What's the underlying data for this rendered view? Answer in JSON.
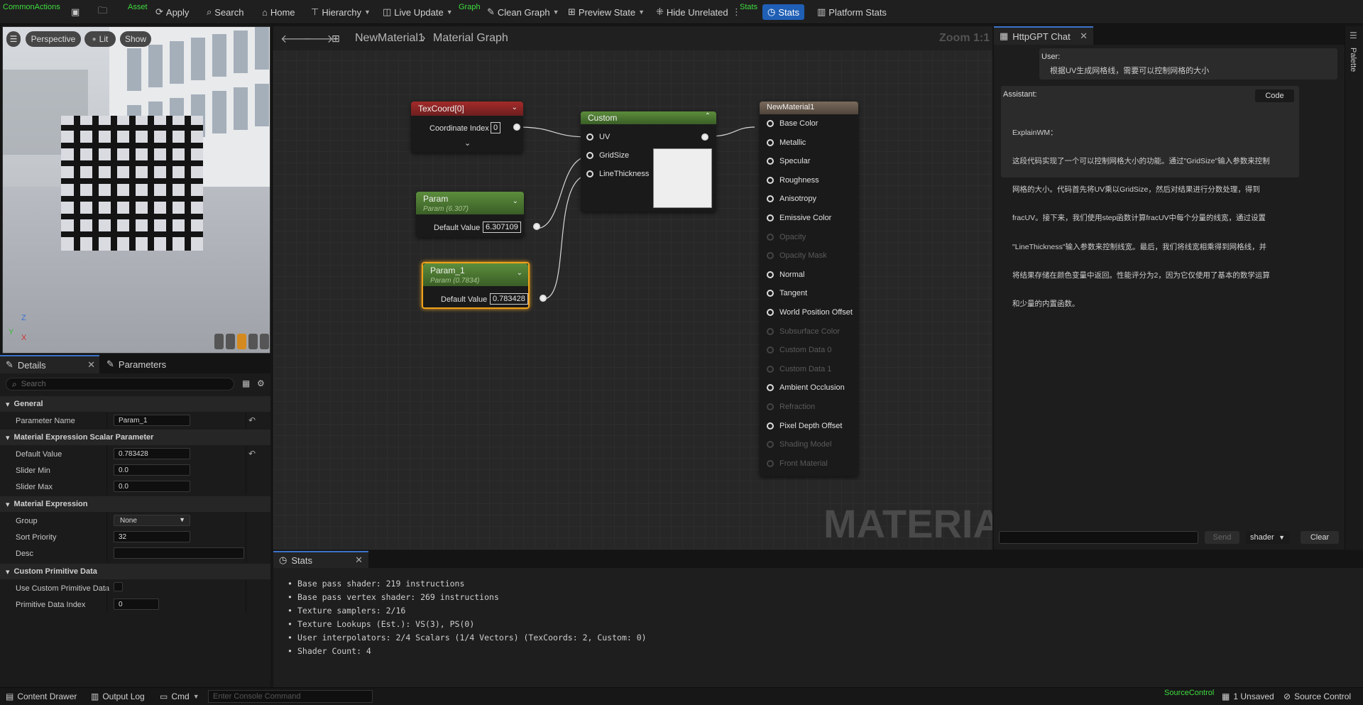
{
  "toolbar": {
    "sections": {
      "common_actions": "CommonActions",
      "asset": "Asset",
      "graph": "Graph",
      "stats": "Stats"
    },
    "apply": "Apply",
    "search": "Search",
    "home": "Home",
    "hierarchy": "Hierarchy",
    "live_update": "Live Update",
    "clean_graph": "Clean Graph",
    "preview_state": "Preview State",
    "hide_unrelated": "Hide Unrelated",
    "stats": "Stats",
    "platform_stats": "Platform Stats"
  },
  "viewport": {
    "perspective": "Perspective",
    "lit": "Lit",
    "show": "Show",
    "axis_z": "Z",
    "axis_y": "Y",
    "axis_x": "X"
  },
  "details": {
    "tab_details": "Details",
    "tab_parameters": "Parameters",
    "search_placeholder": "Search",
    "sections": {
      "general": "General",
      "scalar": "Material Expression Scalar Parameter",
      "expression": "Material Expression",
      "custom_primitive": "Custom Primitive Data"
    },
    "props": {
      "parameter_name": {
        "label": "Parameter Name",
        "value": "Param_1"
      },
      "default_value": {
        "label": "Default Value",
        "value": "0.783428"
      },
      "slider_min": {
        "label": "Slider Min",
        "value": "0.0"
      },
      "slider_max": {
        "label": "Slider Max",
        "value": "0.0"
      },
      "group": {
        "label": "Group",
        "value": "None"
      },
      "sort_priority": {
        "label": "Sort Priority",
        "value": "32"
      },
      "desc": {
        "label": "Desc",
        "value": ""
      },
      "use_custom_primitive": {
        "label": "Use Custom Primitive Data"
      },
      "primitive_index": {
        "label": "Primitive Data Index",
        "value": "0"
      }
    }
  },
  "graph": {
    "breadcrumb_material": "NewMaterial1",
    "breadcrumb_graph": "Material Graph",
    "zoom": "Zoom 1:1",
    "watermark": "MATERIAL",
    "texcoord": {
      "title": "TexCoord[0]",
      "coordinate_index_label": "Coordinate Index",
      "coordinate_index": "0"
    },
    "param": {
      "title": "Param",
      "subtitle": "Param (6.307)",
      "default_label": "Default Value",
      "default_value": "6.307109"
    },
    "param1": {
      "title": "Param_1",
      "subtitle": "Param (0.7834)",
      "default_label": "Default Value",
      "default_value": "0.783428"
    },
    "custom": {
      "title": "Custom",
      "pins": [
        "UV",
        "GridSize",
        "LineThickness"
      ]
    },
    "result": {
      "title": "NewMaterial1",
      "pins": [
        {
          "label": "Base Color",
          "active": true
        },
        {
          "label": "Metallic",
          "active": true
        },
        {
          "label": "Specular",
          "active": true
        },
        {
          "label": "Roughness",
          "active": true
        },
        {
          "label": "Anisotropy",
          "active": true
        },
        {
          "label": "Emissive Color",
          "active": true
        },
        {
          "label": "Opacity",
          "active": false
        },
        {
          "label": "Opacity Mask",
          "active": false
        },
        {
          "label": "Normal",
          "active": true
        },
        {
          "label": "Tangent",
          "active": true
        },
        {
          "label": "World Position Offset",
          "active": true
        },
        {
          "label": "Subsurface Color",
          "active": false
        },
        {
          "label": "Custom Data 0",
          "active": false
        },
        {
          "label": "Custom Data 1",
          "active": false
        },
        {
          "label": "Ambient Occlusion",
          "active": true
        },
        {
          "label": "Refraction",
          "active": false
        },
        {
          "label": "Pixel Depth Offset",
          "active": true
        },
        {
          "label": "Shading Model",
          "active": false
        },
        {
          "label": "Front Material",
          "active": false
        }
      ]
    }
  },
  "chat": {
    "tab_title": "HttpGPT Chat",
    "palette": "Palette",
    "user_label": "User:",
    "user_message": "根据UV生成网格线，需要可以控制网格的大小",
    "assistant_label": "Assistant:",
    "code_button": "Code",
    "assistant_lines": [
      "ExplainWM：",
      "这段代码实现了一个可以控制网格大小的功能。通过\"GridSize\"输入参数来控制",
      "网格的大小。代码首先将UV乘以GridSize，然后对结果进行分数处理，得到",
      "fracUV。接下来，我们使用step函数计算fracUV中每个分量的线宽，通过设置",
      "\"LineThickness\"输入参数来控制线宽。最后，我们将线宽相乘得到网格线，并",
      "将结果存储在颜色变量中返回。性能评分为2，因为它仅使用了基本的数学运算",
      "和少量的内置函数。"
    ],
    "send": "Send",
    "mode": "shader",
    "clear": "Clear"
  },
  "stats": {
    "tab": "Stats",
    "lines": [
      "Base pass shader: 219 instructions",
      "Base pass vertex shader: 269 instructions",
      "Texture samplers: 2/16",
      "Texture Lookups (Est.): VS(3), PS(0)",
      "User interpolators: 2/4 Scalars (1/4 Vectors) (TexCoords: 2, Custom: 0)",
      "Shader Count: 4"
    ]
  },
  "bottom": {
    "content_drawer": "Content Drawer",
    "output_log": "Output Log",
    "cmd": "Cmd",
    "console_placeholder": "Enter Console Command",
    "source_control_section": "SourceControl",
    "unsaved": "1 Unsaved",
    "source_control": "Source Control"
  }
}
